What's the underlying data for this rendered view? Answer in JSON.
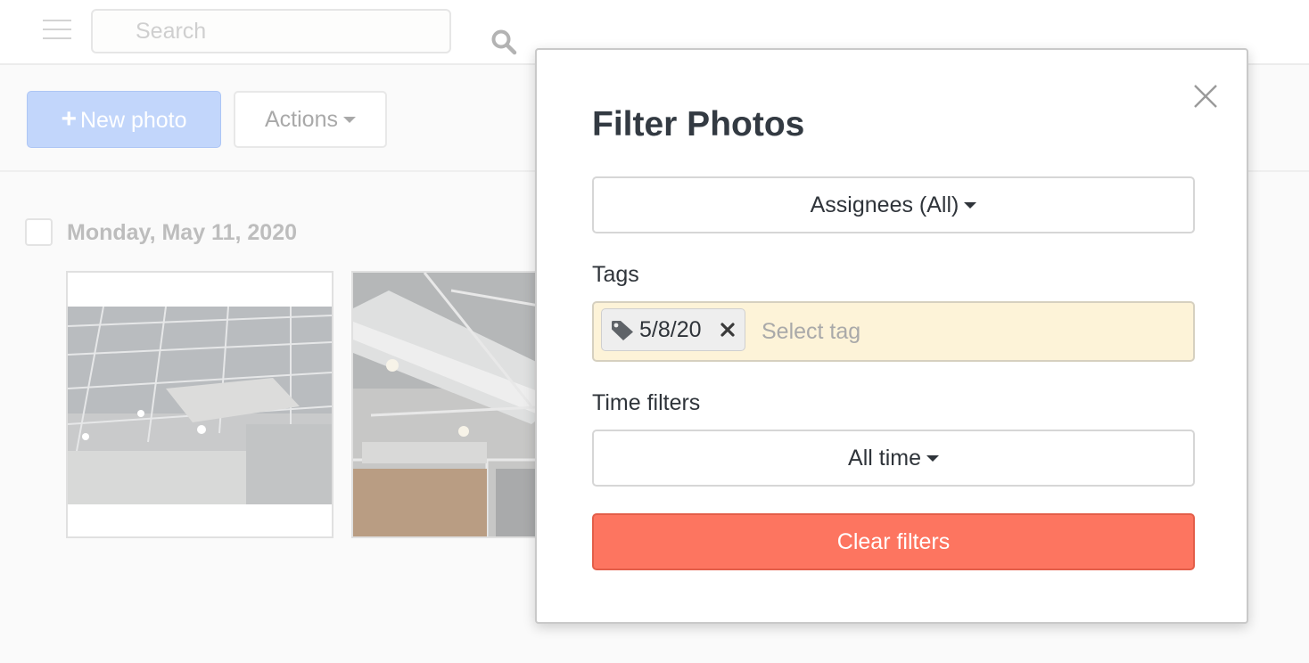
{
  "topbar": {
    "search": {
      "placeholder": "Search",
      "value": ""
    },
    "icons": {
      "menu": "hamburger-icon",
      "search": "search-icon"
    }
  },
  "toolbar": {
    "new_photo_label": "New photo",
    "actions_label": "Actions"
  },
  "photos": {
    "date_group": "Monday, May 11, 2020",
    "items": [
      {
        "subject": "ceiling-grid"
      },
      {
        "subject": "ductwork"
      }
    ]
  },
  "modal": {
    "title": "Filter Photos",
    "assignees_label": "Assignees (All)",
    "tags_label": "Tags",
    "tags": [
      {
        "label": "5/8/20",
        "icon": "tag-icon"
      }
    ],
    "tag_placeholder": "Select tag",
    "time_filters_label": "Time filters",
    "time_filter_value": "All time",
    "clear_label": "Clear filters"
  },
  "colors": {
    "primary_disabled": "#c2d6fb",
    "danger": "#fd7560",
    "tags_bg": "#fdf3d8",
    "title_text": "#333a42"
  }
}
